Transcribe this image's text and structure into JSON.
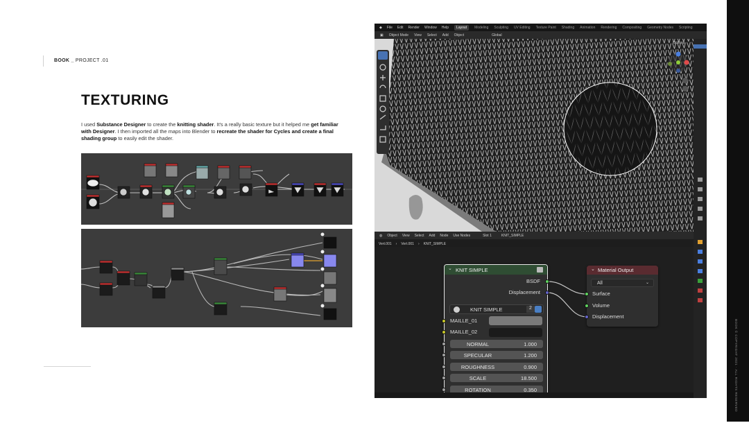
{
  "book": {
    "prefix": "BOOK _",
    "project": "PROJECT .01"
  },
  "title": "TEXTURING",
  "description": {
    "p1": "I used ",
    "b1": "Substance Designer",
    "p2": " to create the ",
    "b2": "knitting shader",
    "p3": ". It's a really basic texture but it helped me ",
    "b3": "get familiar with Designer",
    "p4": ". I then imported all the maps into Blender to ",
    "b4": "recreate the shader for Cycles and create a final shading group",
    "p5": " to easily edit the shader."
  },
  "side_text": "BOOK © COPYRIGHT 2021 · ALL RIGHTS RESERVED",
  "blender": {
    "menus": [
      "File",
      "Edit",
      "Render",
      "Window",
      "Help"
    ],
    "workspaces": [
      "Layout",
      "Modeling",
      "Sculpting",
      "UV Editing",
      "Texture Paint",
      "Shading",
      "Animation",
      "Rendering",
      "Compositing",
      "Geometry Nodes",
      "Scripting"
    ],
    "active_workspace": "Layout",
    "viewport_header": [
      "Object Mode",
      "View",
      "Select",
      "Add",
      "Object",
      "Global"
    ],
    "options_label": "Options",
    "node_header": [
      "Object",
      "View",
      "Select",
      "Add",
      "Node",
      "Use Nodes",
      "Slot 1",
      "KNIT_SIMPLE"
    ],
    "breadcrumb": [
      "Vert.001",
      "Vert.001",
      "KNIT_SIMPLE"
    ],
    "group_node": {
      "title": "KNIT SIMPLE",
      "outputs": [
        "BSDF",
        "Displacement"
      ],
      "group_name": "KNIT SIMPLE",
      "users": "2",
      "color_inputs": [
        "MAILLE_01",
        "MAILLE_02"
      ],
      "inputs": [
        {
          "label": "NORMAL",
          "value": "1.000"
        },
        {
          "label": "SPECULAR",
          "value": "1.200"
        },
        {
          "label": "ROUGHNESS",
          "value": "0.900"
        },
        {
          "label": "SCALE",
          "value": "18.500"
        },
        {
          "label": "ROTATION",
          "value": "0.350"
        }
      ]
    },
    "output_node": {
      "title": "Material Output",
      "target": "All",
      "inputs": [
        "Surface",
        "Volume",
        "Displacement"
      ]
    }
  },
  "colors": {
    "socket_shader": "#5fd35f",
    "socket_vector": "#6363c7",
    "socket_color": "#c7c729",
    "socket_float": "#a1a1a1",
    "group_header": "#2f4d33",
    "output_header": "#5a2b30",
    "selection": "#e8e8e8"
  }
}
